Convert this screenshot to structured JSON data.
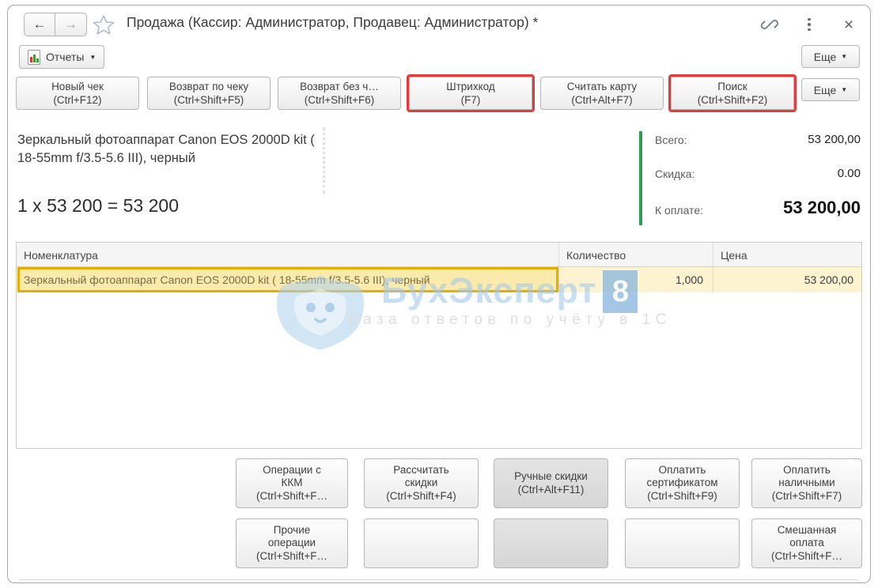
{
  "window": {
    "title": "Продажа (Кассир: Администратор, Продавец: Администратор) *",
    "reports_button_label": "Отчеты",
    "more_top_label": "Еще",
    "more_toolbar_label": "Еще",
    "back_glyph": "←",
    "forward_glyph": "→",
    "close_glyph": "×"
  },
  "toolbar": {
    "buttons": [
      {
        "label": "Новый чек",
        "shortcut": "(Ctrl+F12)",
        "highlight": false
      },
      {
        "label": "Возврат по чеку",
        "shortcut": "(Ctrl+Shift+F5)",
        "highlight": false
      },
      {
        "label": "Возврат без ч…",
        "shortcut": "(Ctrl+Shift+F6)",
        "highlight": false
      },
      {
        "label": "Штрихкод",
        "shortcut": "(F7)",
        "highlight": true
      },
      {
        "label": "Считать карту",
        "shortcut": "(Ctrl+Alt+F7)",
        "highlight": false
      },
      {
        "label": "Поиск",
        "shortcut": "(Ctrl+Shift+F2)",
        "highlight": true
      }
    ]
  },
  "current_item": {
    "name": "Зеркальный фотоаппарат Canon EOS 2000D kit ( 18-55mm f/3.5-5.6 III), черный",
    "calc": "1 x 53 200 = 53 200"
  },
  "totals": {
    "total_label": "Всего:",
    "total_value": "53 200,00",
    "discount_label": "Скидка:",
    "discount_value": "0.00",
    "due_label": "К оплате:",
    "due_value": "53 200,00"
  },
  "table": {
    "columns": [
      "Номенклатура",
      "Количество",
      "Цена"
    ],
    "rows": [
      {
        "name": "Зеркальный фотоаппарат Canon EOS 2000D kit ( 18-55mm f/3.5-5.6 III), черный",
        "qty": "1,000",
        "price": "53 200,00"
      }
    ]
  },
  "watermark": {
    "brand": "БухЭксперт",
    "badge": "8",
    "tagline": "База ответов по учёту в 1С"
  },
  "actions": {
    "row1": [
      {
        "lines": [
          "Операции с",
          "ККМ",
          "(Ctrl+Shift+F…"
        ],
        "style": "normal"
      },
      {
        "lines": [
          "Рассчитать",
          "скидки",
          "(Ctrl+Shift+F4)"
        ],
        "style": "normal"
      },
      {
        "lines": [
          "Ручные скидки",
          "(Ctrl+Alt+F11)"
        ],
        "style": "pressed"
      },
      {
        "lines": [
          "Оплатить",
          "сертификатом",
          "(Ctrl+Shift+F9)"
        ],
        "style": "normal"
      },
      {
        "lines": [
          "Оплатить",
          "наличными",
          "(Ctrl+Shift+F7)"
        ],
        "style": "normal"
      }
    ],
    "row2": [
      {
        "lines": [
          "Прочие",
          "операции",
          "(Ctrl+Shift+F…"
        ],
        "style": "normal"
      },
      {
        "lines": [],
        "style": "normal"
      },
      {
        "lines": [],
        "style": "pressed"
      },
      {
        "lines": [],
        "style": "normal"
      },
      {
        "lines": [
          "Смешанная",
          "оплата",
          "(Ctrl+Shift+F…"
        ],
        "style": "normal"
      }
    ]
  },
  "colors": {
    "annotation_red": "#e23b3b",
    "annotation_yellow": "#e3ae06",
    "row_highlight_bg": "#fdf3d0",
    "totals_green_bar": "#2e9e54",
    "watermark_blue": "#a9cbe8"
  }
}
